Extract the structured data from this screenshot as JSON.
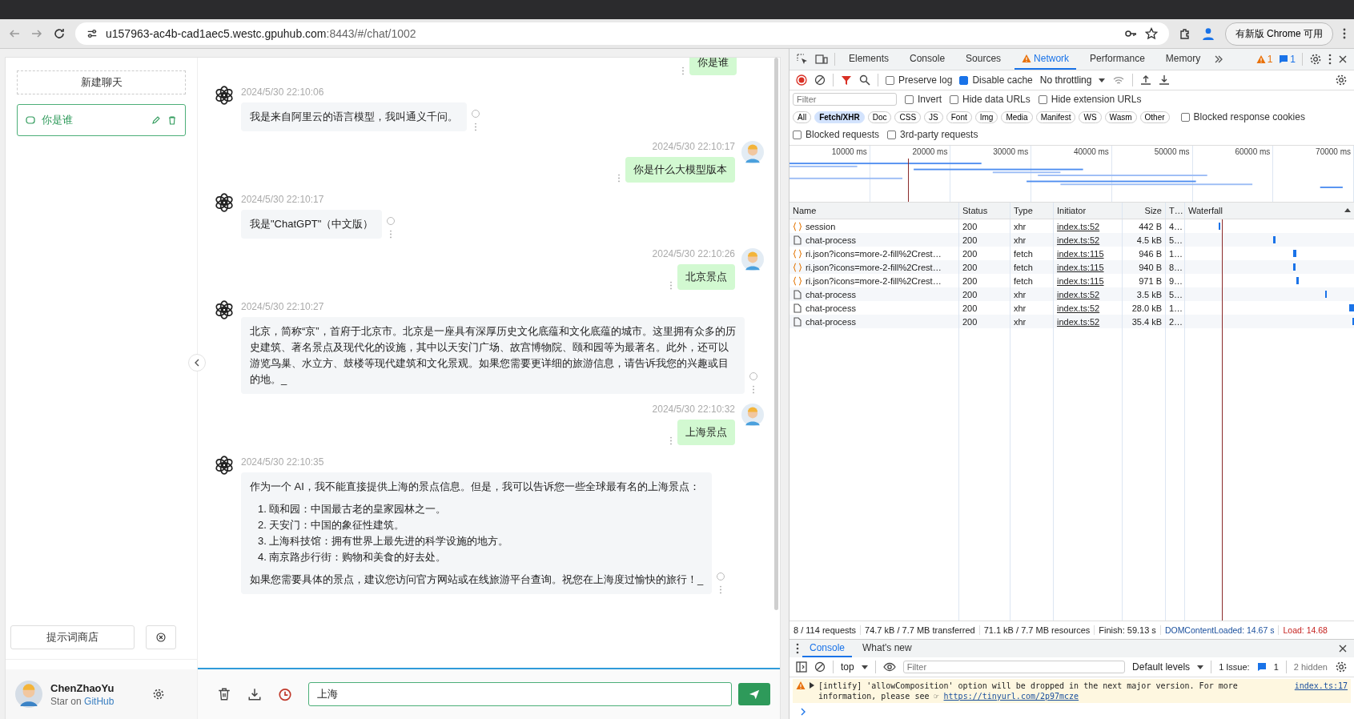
{
  "browser": {
    "url_host": "u157963-ac4b-cad1aec5.westc.gpuhub.com",
    "url_path": ":8443/#/chat/1002",
    "update_button": "有新版 Chrome 可用"
  },
  "sidebar": {
    "new_chat": "新建聊天",
    "sessions": [
      {
        "title": "你是谁",
        "selected": true
      }
    ],
    "prompt_store": "提示词商店",
    "user": {
      "name": "ChenZhaoYu",
      "tagline": "Star on",
      "link": "GitHub"
    }
  },
  "chat": {
    "messages": [
      {
        "kind": "user",
        "text": "你是谁"
      },
      {
        "kind": "assistant",
        "time": "2024/5/30 22:10:06",
        "blocks": [
          {
            "kind": "p",
            "text": "我是来自阿里云的语言模型，我叫通义千问。"
          }
        ]
      },
      {
        "kind": "user",
        "time": "2024/5/30 22:10:17",
        "text": "你是什么大模型版本"
      },
      {
        "kind": "assistant",
        "time": "2024/5/30 22:10:17",
        "blocks": [
          {
            "kind": "p",
            "text": "我是\"ChatGPT\"（中文版）"
          }
        ]
      },
      {
        "kind": "user",
        "time": "2024/5/30 22:10:26",
        "text": "北京景点"
      },
      {
        "kind": "assistant",
        "time": "2024/5/30 22:10:27",
        "blocks": [
          {
            "kind": "p",
            "text": "北京，简称“京”，首府于北京市。北京是一座具有深厚历史文化底蕴和文化底蕴的城市。这里拥有众多的历史建筑、著名景点及现代化的设施，其中以天安门广场、故宫博物院、颐和园等为最著名。此外，还可以游览鸟巢、水立方、鼓楼等现代建筑和文化景观。如果您需要更详细的旅游信息，请告诉我您的兴趣或目的地。_"
          }
        ]
      },
      {
        "kind": "user",
        "time": "2024/5/30 22:10:32",
        "text": "上海景点"
      },
      {
        "kind": "assistant",
        "time": "2024/5/30 22:10:35",
        "blocks": [
          {
            "kind": "p",
            "text": "作为一个 AI，我不能直接提供上海的景点信息。但是，我可以告诉您一些全球最有名的上海景点："
          },
          {
            "kind": "item",
            "text": "1. 颐和园：中国最古老的皇家园林之一。"
          },
          {
            "kind": "item",
            "text": "2. 天安门：中国的象征性建筑。"
          },
          {
            "kind": "item",
            "text": "3. 上海科技馆：拥有世界上最先进的科学设施的地方。"
          },
          {
            "kind": "item",
            "text": "4. 南京路步行街：购物和美食的好去处。"
          },
          {
            "kind": "p",
            "text": "如果您需要具体的景点，建议您访问官方网站或在线旅游平台查询。祝您在上海度过愉快的旅行！_"
          }
        ]
      }
    ],
    "input": "上海"
  },
  "devtools": {
    "tabs": [
      {
        "label": "Elements",
        "selected": false,
        "warning": false
      },
      {
        "label": "Console",
        "selected": false,
        "warning": false
      },
      {
        "label": "Sources",
        "selected": false,
        "warning": false
      },
      {
        "label": "Network",
        "selected": true,
        "warning": true
      },
      {
        "label": "Performance",
        "selected": false,
        "warning": false
      },
      {
        "label": "Memory",
        "selected": false,
        "warning": false
      }
    ],
    "warning_count": "1",
    "message_count": "1",
    "preserve_log": {
      "label": "Preserve log",
      "checked": false
    },
    "disable_cache": {
      "label": "Disable cache",
      "checked": true
    },
    "throttling": "No throttling",
    "filter_placeholder": "Filter",
    "filter_checks": [
      {
        "label": "Invert",
        "checked": false
      },
      {
        "label": "Hide data URLs",
        "checked": false
      },
      {
        "label": "Hide extension URLs",
        "checked": false
      }
    ],
    "types": [
      {
        "label": "All",
        "selected": false
      },
      {
        "label": "Fetch/XHR",
        "selected": true
      },
      {
        "label": "Doc",
        "selected": false
      },
      {
        "label": "CSS",
        "selected": false
      },
      {
        "label": "JS",
        "selected": false
      },
      {
        "label": "Font",
        "selected": false
      },
      {
        "label": "Img",
        "selected": false
      },
      {
        "label": "Media",
        "selected": false
      },
      {
        "label": "Manifest",
        "selected": false
      },
      {
        "label": "WS",
        "selected": false
      },
      {
        "label": "Wasm",
        "selected": false
      },
      {
        "label": "Other",
        "selected": false
      }
    ],
    "blocked_cookies": {
      "label": "Blocked response cookies",
      "checked": false
    },
    "more_checks": [
      {
        "label": "Blocked requests",
        "checked": false
      },
      {
        "label": "3rd-party requests",
        "checked": false
      }
    ],
    "overview_ticks": [
      "10000 ms",
      "20000 ms",
      "30000 ms",
      "40000 ms",
      "50000 ms",
      "60000 ms",
      "70000 ms"
    ],
    "columns": [
      "Name",
      "Status",
      "Type",
      "Initiator",
      "Size",
      "T…",
      "Waterfall"
    ],
    "rows": [
      {
        "kind": "json",
        "name": "session",
        "status": "200",
        "type": "xhr",
        "initiator": "index.ts:52",
        "size": "442 B",
        "time": "4…"
      },
      {
        "kind": "doc",
        "name": "chat-process",
        "status": "200",
        "type": "xhr",
        "initiator": "index.ts:52",
        "size": "4.5 kB",
        "time": "5…"
      },
      {
        "kind": "json",
        "name": "ri.json?icons=more-2-fill%2Crest…",
        "status": "200",
        "type": "fetch",
        "initiator": "index.ts:115",
        "size": "946 B",
        "time": "1…"
      },
      {
        "kind": "json",
        "name": "ri.json?icons=more-2-fill%2Crest…",
        "status": "200",
        "type": "fetch",
        "initiator": "index.ts:115",
        "size": "940 B",
        "time": "8…"
      },
      {
        "kind": "json",
        "name": "ri.json?icons=more-2-fill%2Crest…",
        "status": "200",
        "type": "fetch",
        "initiator": "index.ts:115",
        "size": "971 B",
        "time": "9…"
      },
      {
        "kind": "doc",
        "name": "chat-process",
        "status": "200",
        "type": "xhr",
        "initiator": "index.ts:52",
        "size": "3.5 kB",
        "time": "5…"
      },
      {
        "kind": "doc",
        "name": "chat-process",
        "status": "200",
        "type": "xhr",
        "initiator": "index.ts:52",
        "size": "28.0 kB",
        "time": "1…"
      },
      {
        "kind": "doc",
        "name": "chat-process",
        "status": "200",
        "type": "xhr",
        "initiator": "index.ts:52",
        "size": "35.4 kB",
        "time": "2…"
      }
    ],
    "summary": [
      {
        "kind": "plain",
        "text": "8 / 114 requests"
      },
      {
        "kind": "plain",
        "text": "74.7 kB / 7.7 MB transferred"
      },
      {
        "kind": "plain",
        "text": "71.1 kB / 7.7 MB resources"
      },
      {
        "kind": "plain",
        "text": "Finish: 59.13 s"
      },
      {
        "kind": "dcl",
        "text": "DOMContentLoaded: 14.67 s"
      },
      {
        "kind": "load",
        "text": "Load: 14.68"
      }
    ],
    "drawer_tabs": [
      {
        "label": "Console",
        "selected": true
      },
      {
        "label": "What's new",
        "selected": false
      }
    ],
    "context": "top",
    "console_filter_placeholder": "Filter",
    "levels": "Default levels",
    "issues_label": "1 Issue:",
    "issues_count": "1",
    "hidden": "2 hidden",
    "console_message": {
      "text": "[intlify] 'allowComposition' option will be dropped in the next major version. For more information, please see ☞",
      "link": "https://tinyurl.com/2p97mcze",
      "source": "index.ts:17"
    }
  }
}
